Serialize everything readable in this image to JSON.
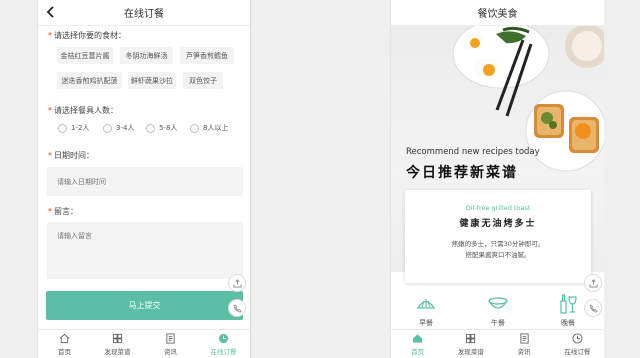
{
  "order_screen": {
    "title": "在线订餐",
    "ingredient_label": "请选择你要的食材：",
    "ingredients": [
      "金桔红豆薏片酱",
      "冬阴功海鲜汤",
      "芦笋香煎鳕鱼",
      "迷迭香煎鸡扒配菠",
      "鲜虾蔬果沙拉",
      "双色饺子"
    ],
    "people_label": "请选择餐具人数：",
    "people_options": [
      "1-2人",
      "3-4人",
      "5-8人",
      "8人以上"
    ],
    "date_label": "日期时间：",
    "date_placeholder": "请输入日期时间",
    "message_label": "留言：",
    "message_placeholder": "请输入留言",
    "submit_label": "马上提交"
  },
  "food_screen": {
    "title": "餐饮美食",
    "hero_en": "Recommend new recipes today",
    "hero_cn": "今日推荐新菜谱",
    "card_subtitle": "Oil-free grilled toast",
    "card_title": "健康无油烤多士",
    "card_desc_line1": "焦嫩的多士，只需30分钟即可。",
    "card_desc_line2": "搭配果酱爽口不油腻。",
    "categories": [
      "早餐",
      "午餐",
      "晚餐"
    ]
  },
  "tabbar": {
    "items": [
      "首页",
      "发现菜谱",
      "资讯",
      "在线订餐"
    ]
  },
  "colors": {
    "accent": "#5cbfa5",
    "required_star": "#e0452c"
  },
  "icons": {
    "float_top": "share-icon",
    "float_bottom": "phone-icon"
  }
}
